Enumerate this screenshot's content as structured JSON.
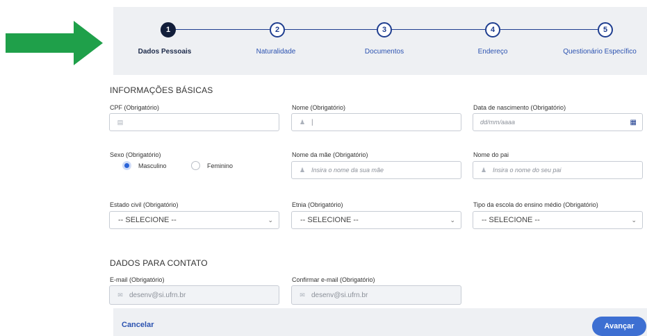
{
  "colors": {
    "arrow": "#1fa04a",
    "primary": "#1e3d8f",
    "accent": "#3d6fd2",
    "link": "#2b52b0"
  },
  "stepper": {
    "steps": [
      {
        "number": "1",
        "label": "Dados Pessoais",
        "active": true
      },
      {
        "number": "2",
        "label": "Naturalidade",
        "active": false
      },
      {
        "number": "3",
        "label": "Documentos",
        "active": false
      },
      {
        "number": "4",
        "label": "Endereço",
        "active": false
      },
      {
        "number": "5",
        "label": "Questionário Específico",
        "active": false
      }
    ]
  },
  "basic_info": {
    "title": "INFORMAÇÕES BÁSICAS",
    "cpf": {
      "label": "CPF (Obrigatório)",
      "icon": "id-card-icon"
    },
    "name": {
      "label": "Nome (Obrigatório)",
      "icon": "user-icon",
      "value": "|"
    },
    "birth_date": {
      "label": "Data de nascimento (Obrigatório)",
      "placeholder": "dd/mm/aaaa",
      "icon": "calendar-icon"
    },
    "sex": {
      "label": "Sexo (Obrigatório)",
      "options": [
        "Masculino",
        "Feminino"
      ],
      "selected": "Masculino"
    },
    "mother_name": {
      "label": "Nome da mãe (Obrigatório)",
      "placeholder": "Insira o nome da sua mãe",
      "icon": "user-icon"
    },
    "father_name": {
      "label": "Nome do pai",
      "placeholder": "Insira o nome do seu pai",
      "icon": "user-icon"
    },
    "civil_status": {
      "label": "Estado civil (Obrigatório)",
      "value": "-- SELECIONE --"
    },
    "ethnicity": {
      "label": "Etnia (Obrigatório)",
      "value": "-- SELECIONE --"
    },
    "school_type": {
      "label": "Tipo da escola do ensino médio (Obrigatório)",
      "value": "-- SELECIONE --"
    }
  },
  "contact": {
    "title": "DADOS PARA CONTATO",
    "email": {
      "label": "E-mail (Obrigatório)",
      "value": "desenv@si.ufrn.br",
      "icon": "mail-icon"
    },
    "confirm_email": {
      "label": "Confirmar e-mail (Obrigatório)",
      "value": "desenv@si.ufrn.br",
      "icon": "mail-icon"
    }
  },
  "footer": {
    "cancel_label": "Cancelar",
    "advance_label": "Avançar"
  }
}
